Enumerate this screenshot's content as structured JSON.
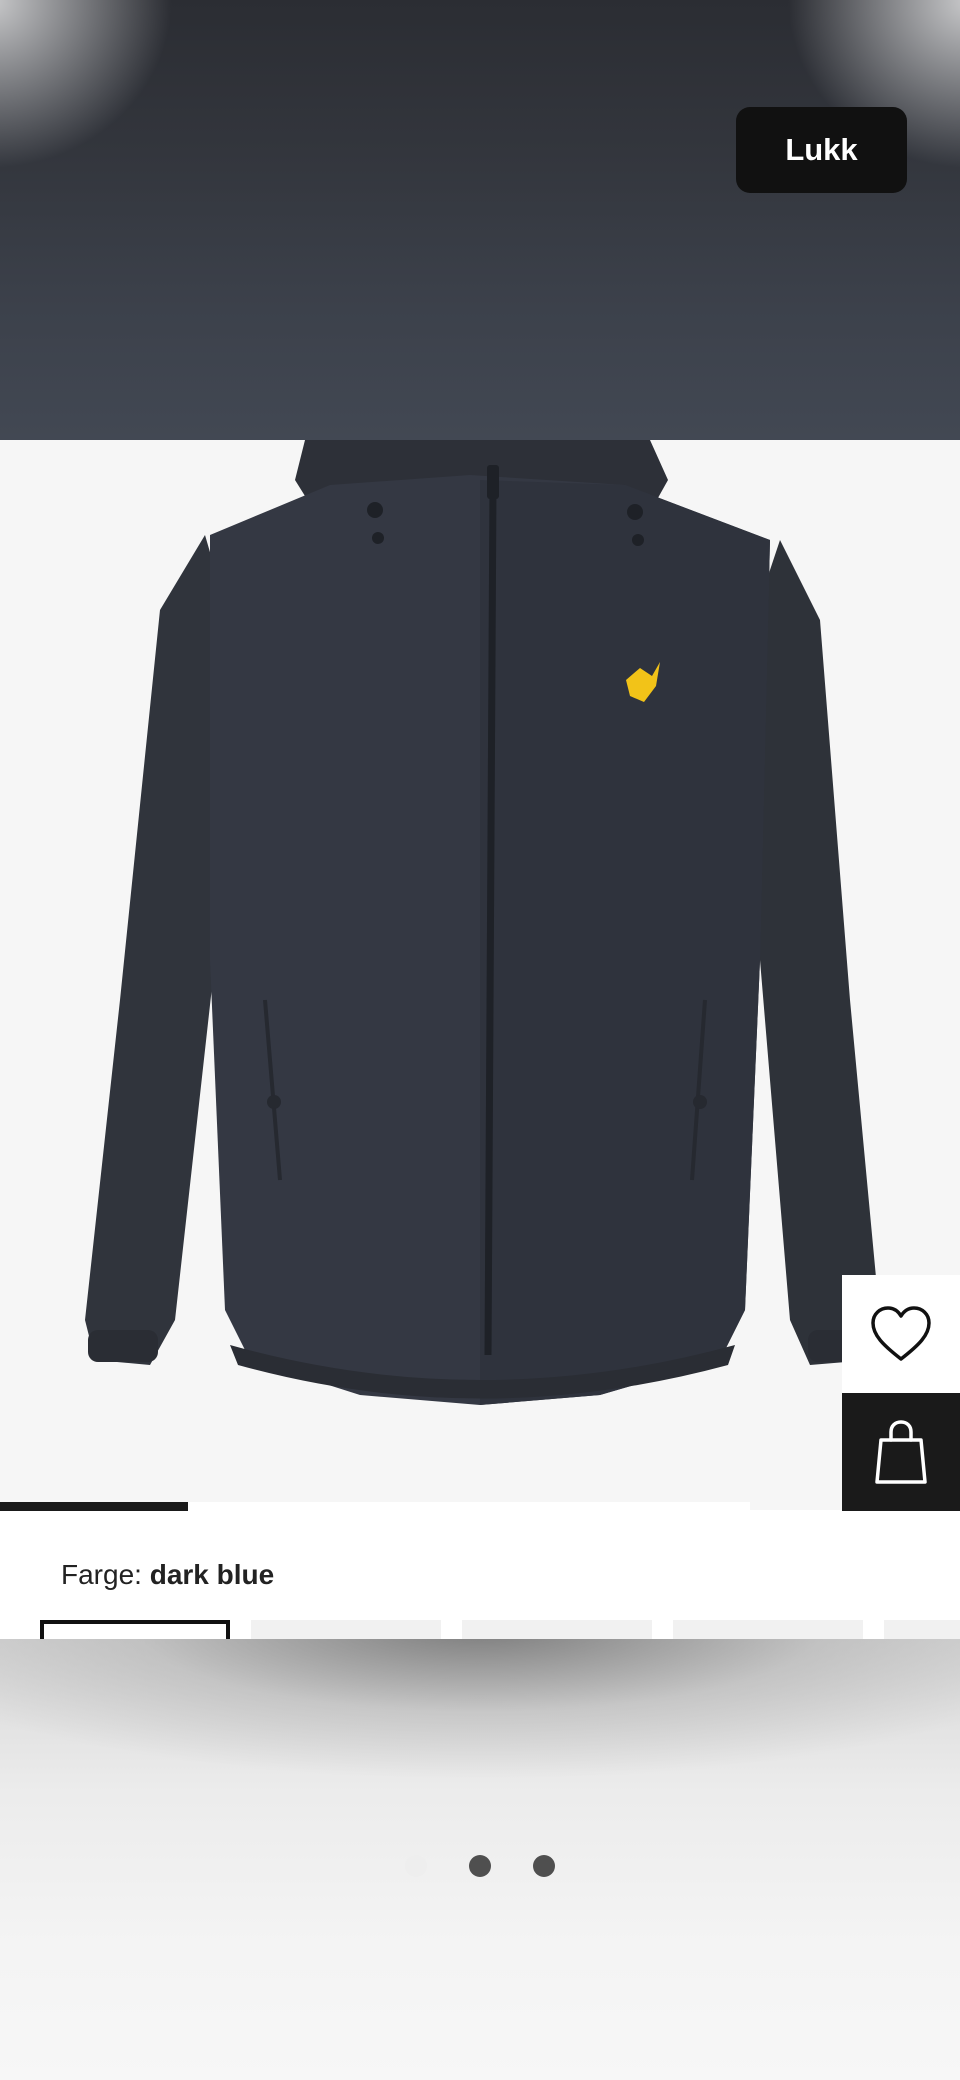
{
  "overlay": {
    "close_label": "Lukk"
  },
  "product": {
    "color_label": "Farge:",
    "color_value": "dark blue",
    "image_index": 1,
    "image_count": 4,
    "swatches": [
      {
        "selected": true
      },
      {
        "selected": false
      },
      {
        "selected": false
      },
      {
        "selected": false
      },
      {
        "selected": false
      }
    ]
  },
  "actions": {
    "wishlist_icon": "heart-outline-icon",
    "cart_icon": "shopping-bag-icon"
  },
  "pager": {
    "count": 3,
    "active_index": 1
  },
  "colors": {
    "jacket": "#2f333c",
    "logo": "#f2c318",
    "button_dark": "#111111"
  }
}
